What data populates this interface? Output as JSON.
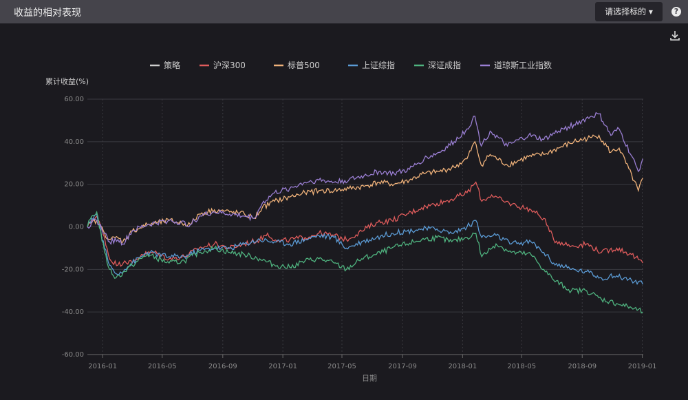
{
  "header": {
    "title": "收益的相对表现",
    "select_label": "请选择标的",
    "select_caret": "▾",
    "help_symbol": "?",
    "download_icon": "download-icon"
  },
  "chart_data": {
    "type": "line",
    "ylabel": "累计收益(%)",
    "xlabel": "日期",
    "ylim": [
      -60,
      60
    ],
    "yticks": [
      -60,
      -40,
      -20,
      0,
      20,
      40,
      60
    ],
    "ytick_labels": [
      "-60.00",
      "-40.00",
      "-20.00",
      "0.00",
      "20.00",
      "40.00",
      "60.00"
    ],
    "x_range": [
      "2015-12-01",
      "2019-01-03"
    ],
    "xticks": [
      "2016-01-01",
      "2016-05-01",
      "2016-09-01",
      "2017-01-01",
      "2017-05-01",
      "2017-09-01",
      "2018-01-01",
      "2018-05-01",
      "2018-09-01",
      "2019-01-01"
    ],
    "xtick_labels": [
      "2016-01",
      "2016-05",
      "2016-09",
      "2017-01",
      "2017-05",
      "2017-09",
      "2018-01",
      "2018-05",
      "2018-09",
      "2019-01"
    ],
    "grid": true,
    "legend_position": "top-center",
    "series": [
      {
        "name": "策略",
        "color": "#cfcfcf",
        "dates": [],
        "values": []
      },
      {
        "name": "沪深300",
        "color": "#e05c5c",
        "dates": [
          "2015-12-01",
          "2015-12-10",
          "2015-12-20",
          "2016-01-05",
          "2016-01-15",
          "2016-02-01",
          "2016-02-15",
          "2016-03-01",
          "2016-03-20",
          "2016-04-15",
          "2016-05-15",
          "2016-06-15",
          "2016-07-15",
          "2016-08-15",
          "2016-09-15",
          "2016-10-15",
          "2016-11-15",
          "2016-12-01",
          "2016-12-20",
          "2017-01-15",
          "2017-02-15",
          "2017-03-15",
          "2017-04-15",
          "2017-05-10",
          "2017-06-10",
          "2017-07-10",
          "2017-08-10",
          "2017-09-10",
          "2017-10-10",
          "2017-11-10",
          "2017-12-10",
          "2018-01-10",
          "2018-01-28",
          "2018-02-09",
          "2018-03-01",
          "2018-03-25",
          "2018-04-20",
          "2018-05-20",
          "2018-06-15",
          "2018-07-05",
          "2018-08-10",
          "2018-09-10",
          "2018-10-10",
          "2018-11-10",
          "2018-12-10",
          "2019-01-02"
        ],
        "values": [
          0,
          3,
          5,
          -5,
          -15,
          -18,
          -16,
          -17,
          -13,
          -12,
          -15,
          -14,
          -10,
          -8,
          -10,
          -8,
          -6,
          -3,
          -7,
          -6,
          -5,
          -3,
          -4,
          -6,
          -2,
          2,
          3,
          6,
          9,
          11,
          13,
          16,
          21,
          12,
          15,
          12,
          10,
          8,
          4,
          -6,
          -9,
          -8,
          -12,
          -10,
          -13,
          -17
        ]
      },
      {
        "name": "标普500",
        "color": "#f0b27a",
        "dates": [
          "2015-12-01",
          "2015-12-10",
          "2015-12-20",
          "2016-01-05",
          "2016-01-15",
          "2016-02-01",
          "2016-02-11",
          "2016-03-01",
          "2016-04-01",
          "2016-05-15",
          "2016-06-27",
          "2016-07-15",
          "2016-08-15",
          "2016-09-15",
          "2016-10-15",
          "2016-11-04",
          "2016-11-20",
          "2016-12-15",
          "2017-01-15",
          "2017-02-15",
          "2017-03-15",
          "2017-04-15",
          "2017-05-15",
          "2017-06-15",
          "2017-07-15",
          "2017-08-15",
          "2017-09-15",
          "2017-10-15",
          "2017-11-15",
          "2017-12-15",
          "2018-01-10",
          "2018-01-26",
          "2018-02-08",
          "2018-02-26",
          "2018-04-02",
          "2018-05-15",
          "2018-06-15",
          "2018-07-15",
          "2018-08-15",
          "2018-09-20",
          "2018-10-05",
          "2018-10-29",
          "2018-11-15",
          "2018-12-24",
          "2019-01-02"
        ],
        "values": [
          0,
          2,
          3,
          -3,
          -6,
          -5,
          -7,
          -2,
          1,
          3,
          1,
          6,
          8,
          7,
          6,
          4,
          9,
          12,
          14,
          16,
          17,
          17,
          18,
          19,
          21,
          20,
          22,
          25,
          26,
          28,
          32,
          40,
          29,
          34,
          29,
          33,
          34,
          37,
          40,
          42,
          43,
          35,
          37,
          17,
          23
        ]
      },
      {
        "name": "上证综指",
        "color": "#5b9bd5",
        "dates": [
          "2015-12-01",
          "2015-12-10",
          "2015-12-20",
          "2016-01-05",
          "2016-01-15",
          "2016-01-28",
          "2016-02-15",
          "2016-03-01",
          "2016-04-01",
          "2016-05-15",
          "2016-06-15",
          "2016-07-15",
          "2016-08-15",
          "2016-09-15",
          "2016-10-15",
          "2016-11-15",
          "2016-12-15",
          "2017-01-15",
          "2017-02-15",
          "2017-03-15",
          "2017-04-15",
          "2017-05-10",
          "2017-06-10",
          "2017-07-10",
          "2017-08-10",
          "2017-09-10",
          "2017-10-10",
          "2017-11-10",
          "2017-12-10",
          "2018-01-10",
          "2018-01-28",
          "2018-02-09",
          "2018-03-10",
          "2018-04-10",
          "2018-05-20",
          "2018-06-15",
          "2018-07-05",
          "2018-08-10",
          "2018-09-10",
          "2018-10-10",
          "2018-11-10",
          "2018-12-10",
          "2019-01-02"
        ],
        "values": [
          0,
          4,
          6,
          -10,
          -18,
          -22,
          -20,
          -17,
          -12,
          -14,
          -14,
          -11,
          -10,
          -10,
          -8,
          -6,
          -7,
          -8,
          -6,
          -4,
          -5,
          -10,
          -7,
          -5,
          -3,
          -2,
          -1,
          -1,
          -3,
          0,
          3,
          -5,
          -4,
          -8,
          -7,
          -12,
          -17,
          -20,
          -21,
          -24,
          -23,
          -25,
          -27
        ]
      },
      {
        "name": "深证成指",
        "color": "#4fb37f",
        "dates": [
          "2015-12-01",
          "2015-12-10",
          "2015-12-20",
          "2016-01-05",
          "2016-01-15",
          "2016-01-28",
          "2016-02-15",
          "2016-03-01",
          "2016-04-01",
          "2016-05-15",
          "2016-06-15",
          "2016-07-15",
          "2016-08-15",
          "2016-09-15",
          "2016-10-15",
          "2016-11-15",
          "2016-12-15",
          "2017-01-15",
          "2017-02-15",
          "2017-03-15",
          "2017-04-15",
          "2017-05-10",
          "2017-06-10",
          "2017-07-10",
          "2017-08-10",
          "2017-09-10",
          "2017-10-10",
          "2017-11-10",
          "2017-12-10",
          "2018-01-10",
          "2018-01-28",
          "2018-02-09",
          "2018-03-10",
          "2018-04-10",
          "2018-05-20",
          "2018-06-15",
          "2018-07-05",
          "2018-08-10",
          "2018-09-10",
          "2018-10-10",
          "2018-11-10",
          "2018-12-10",
          "2019-01-02"
        ],
        "values": [
          0,
          5,
          7,
          -12,
          -20,
          -24,
          -21,
          -18,
          -13,
          -17,
          -16,
          -12,
          -10,
          -12,
          -13,
          -15,
          -18,
          -19,
          -16,
          -15,
          -17,
          -20,
          -15,
          -13,
          -10,
          -8,
          -6,
          -5,
          -7,
          -5,
          -3,
          -14,
          -8,
          -12,
          -13,
          -20,
          -25,
          -30,
          -30,
          -34,
          -36,
          -38,
          -40
        ]
      },
      {
        "name": "道琼斯工业指数",
        "color": "#9b7fd4",
        "dates": [
          "2015-12-01",
          "2015-12-10",
          "2015-12-20",
          "2016-01-05",
          "2016-01-15",
          "2016-02-01",
          "2016-02-11",
          "2016-03-01",
          "2016-04-01",
          "2016-05-15",
          "2016-06-27",
          "2016-07-15",
          "2016-08-15",
          "2016-09-15",
          "2016-10-15",
          "2016-11-04",
          "2016-11-20",
          "2016-12-15",
          "2017-01-15",
          "2017-02-15",
          "2017-03-15",
          "2017-04-15",
          "2017-05-15",
          "2017-06-15",
          "2017-07-15",
          "2017-08-15",
          "2017-09-15",
          "2017-10-15",
          "2017-11-15",
          "2017-12-15",
          "2018-01-10",
          "2018-01-26",
          "2018-02-08",
          "2018-02-26",
          "2018-04-02",
          "2018-05-15",
          "2018-06-15",
          "2018-07-15",
          "2018-08-15",
          "2018-09-20",
          "2018-10-05",
          "2018-10-29",
          "2018-11-15",
          "2018-12-24",
          "2019-01-02"
        ],
        "values": [
          0,
          2,
          3,
          -3,
          -7,
          -6,
          -8,
          -2,
          1,
          3,
          1,
          5,
          7,
          6,
          5,
          4,
          11,
          16,
          18,
          21,
          22,
          21,
          22,
          24,
          26,
          25,
          27,
          32,
          35,
          40,
          46,
          52,
          38,
          45,
          38,
          43,
          41,
          45,
          48,
          52,
          53,
          43,
          46,
          26,
          32
        ]
      }
    ]
  }
}
